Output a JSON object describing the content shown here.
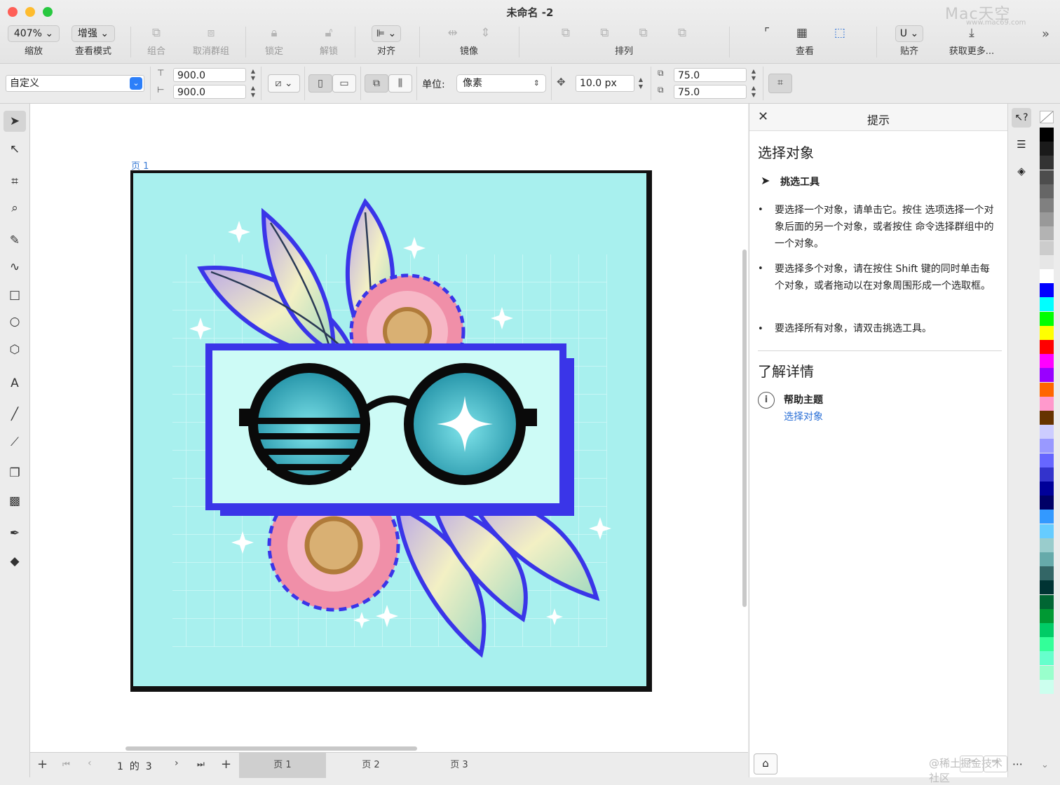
{
  "window": {
    "title": "未命名 -2",
    "watermark": "Mac天空",
    "watermark_url": "www.mac69.com",
    "bottom_watermark": "@稀土掘金技术社区"
  },
  "toolbar": {
    "zoom_value": "407%",
    "zoom_label": "缩放",
    "view_mode_value": "增强",
    "view_mode_label": "查看模式",
    "group_label": "组合",
    "ungroup_label": "取消群组",
    "lock_label": "锁定",
    "unlock_label": "解锁",
    "align_label": "对齐",
    "mirror_label": "镜像",
    "arrange_label": "排列",
    "view_label": "查看",
    "snap_label": "贴齐",
    "get_more_label": "获取更多..."
  },
  "propbar": {
    "page_preset": "自定义",
    "width": "900.0",
    "height": "900.0",
    "unit_label": "单位:",
    "unit_value": "像素",
    "nudge": "10.0 px",
    "dup_x": "75.0",
    "dup_y": "75.0"
  },
  "canvas": {
    "page_label": "页 1",
    "artwork_colors": {
      "bg": "#a8f0ee",
      "frame": "#3a35e8",
      "glasses": "#0a0a0a"
    }
  },
  "bottombar": {
    "page_num": "1",
    "page_of": "的",
    "page_total": "3",
    "tabs": [
      "页 1",
      "页 2",
      "页 3"
    ]
  },
  "hints": {
    "panel_title": "提示",
    "section_title": "选择对象",
    "tool_name": "挑选工具",
    "bullets": [
      "要选择一个对象，请单击它。按住 选项选择一个对象后面的另一个对象，或者按住 命令选择群组中的一个对象。",
      "要选择多个对象，请在按住 Shift 键的同时单击每个对象，或者拖动以在对象周围形成一个选取框。",
      "要选择所有对象，请双击挑选工具。"
    ],
    "learn_more_title": "了解详情",
    "help_topic_label": "帮助主题",
    "help_link": "选择对象"
  },
  "palette": [
    "#000000",
    "#1a1a1a",
    "#333333",
    "#4d4d4d",
    "#666666",
    "#808080",
    "#999999",
    "#b3b3b3",
    "#cccccc",
    "#e6e6e6",
    "#ffffff",
    "#0000ff",
    "#00ffff",
    "#00ff00",
    "#ffff00",
    "#ff0000",
    "#ff00ff",
    "#9900ff",
    "#ff6600",
    "#ff99cc",
    "#663300",
    "#ccccff",
    "#9999ff",
    "#6666ff",
    "#3333cc",
    "#000099",
    "#000066",
    "#3399ff",
    "#66ccff",
    "#99cccc",
    "#66aaaa",
    "#336666",
    "#003333",
    "#006633",
    "#009933",
    "#00cc66",
    "#33ff99",
    "#66ffcc",
    "#99ffcc",
    "#ccffee"
  ]
}
